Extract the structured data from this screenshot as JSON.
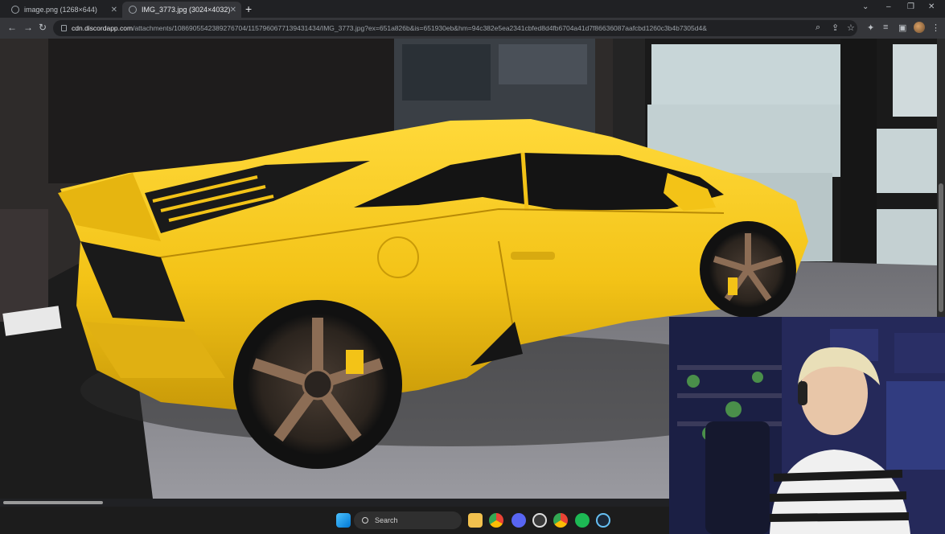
{
  "browser": {
    "tabs": [
      {
        "label": "image.png (1268×644)",
        "active": false
      },
      {
        "label": "IMG_3773.jpg (3024×4032)",
        "active": true
      }
    ],
    "address_host": "cdn.discordapp.com",
    "address_path": "/attachments/1086905542389276704/1157960677139431434/IMG_3773.jpg?ex=651a826b&is=651930eb&hm=94c382e5ea2341cbfed8d4fb6704a41d7f86636087aafcbd1260c3b4b7305d4&",
    "icons": [
      "back-icon",
      "forward-icon",
      "reload-icon",
      "lock-icon",
      "zoom-icon",
      "share-icon",
      "star-icon",
      "extensions-icon",
      "menu-icon"
    ]
  },
  "taskbar": {
    "search_label": "Search",
    "apps": [
      "windows-start-icon",
      "files-icon",
      "chrome-icon",
      "discord-icon",
      "obs-icon",
      "chrome-icon",
      "spotify-icon",
      "steam-icon"
    ]
  },
  "colors": {
    "car_yellow": "#f3c317",
    "chrome_bar": "#35363a",
    "tab_strip": "#202124"
  }
}
